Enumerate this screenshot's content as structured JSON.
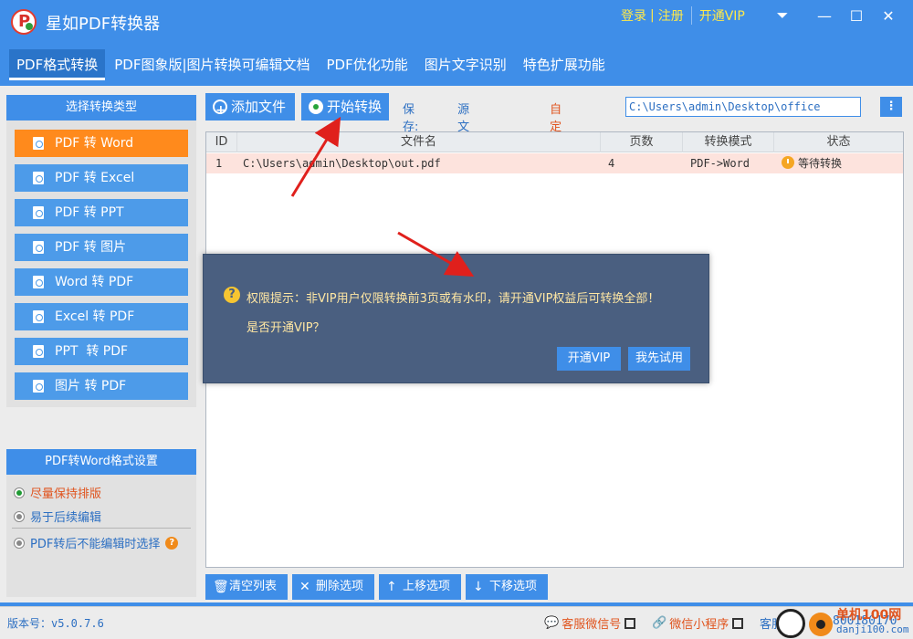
{
  "app": {
    "title": "星如PDF转换器",
    "logo_letter": "P"
  },
  "title_links": {
    "login": "登录",
    "sep": "|",
    "register": "注册",
    "vip": "开通VIP"
  },
  "window_controls": {
    "menu": "⏷",
    "minimize": "—",
    "maximize": "☐",
    "close": "✕"
  },
  "tabs": [
    {
      "label": "PDF格式转换",
      "active": true
    },
    {
      "label": "PDF图象版|图片转换可编辑文档"
    },
    {
      "label": "PDF优化功能"
    },
    {
      "label": "图片文字识别"
    },
    {
      "label": "特色扩展功能"
    }
  ],
  "sidebar": {
    "header": "选择转换类型",
    "items": [
      {
        "label": "PDF 转 Word",
        "active": true
      },
      {
        "label": "PDF 转 Excel"
      },
      {
        "label": "PDF 转 PPT"
      },
      {
        "label": "PDF 转 图片"
      },
      {
        "label": "Word 转 PDF"
      },
      {
        "label": "Excel 转 PDF"
      },
      {
        "label": "PPT  转 PDF"
      },
      {
        "label": "图片 转 PDF"
      }
    ]
  },
  "settings": {
    "header": "PDF转Word格式设置",
    "options": [
      {
        "label": "尽量保持排版",
        "selected": true
      },
      {
        "label": "易于后续编辑"
      },
      {
        "label": "PDF转后不能编辑时选择"
      }
    ]
  },
  "toolbar": {
    "add_file": "添加文件",
    "start": "开始转换",
    "save_label": "保存:",
    "opt_source": "源文件目录",
    "opt_custom": "自定义目录",
    "path": "C:\\Users\\admin\\Desktop\\office",
    "path_btn": "⋮"
  },
  "table": {
    "headers": [
      "ID",
      "文件名",
      "页数",
      "转换模式",
      "状态"
    ],
    "rows": [
      {
        "id": "1",
        "file": "C:\\Users\\admin\\Desktop\\out.pdf",
        "pages": "4",
        "mode": "PDF->Word",
        "status": "等待转换"
      }
    ]
  },
  "bottom_buttons": {
    "clear": "清空列表",
    "delete": "删除选项",
    "up": "上移选项",
    "down": "下移选项"
  },
  "dialog": {
    "message": "权限提示：非VIP用户仅限转换前3页或有水印，请开通VIP权益后可转换全部！",
    "question": "是否开通VIP？",
    "btn_vip": "开通VIP",
    "btn_try": "我先试用"
  },
  "status": {
    "version": "版本号：v5.0.7.6",
    "wechat": "客服微信号",
    "miniprogram": "微信小程序",
    "service_prefix": "客服",
    "phone": "800180170"
  },
  "watermark": {
    "text1": "单机100网",
    "text2": "danji100.com"
  },
  "colors": {
    "accent": "#3f8ee8",
    "active_orange": "#ff8a1c",
    "dialog_bg": "#4a5f80",
    "arrow_red": "#e0201c"
  }
}
